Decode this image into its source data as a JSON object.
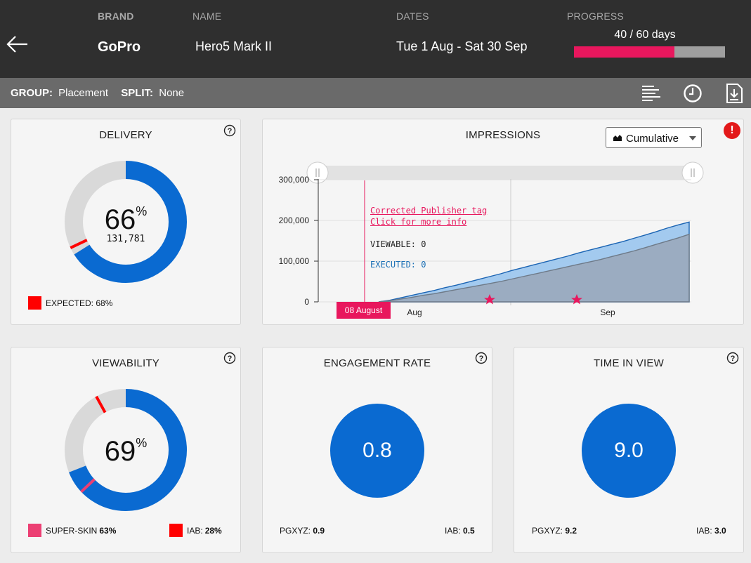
{
  "header": {
    "brand_label": "BRAND",
    "brand_value": "GoPro",
    "name_label": "NAME",
    "name_value": "Hero5 Mark II",
    "dates_label": "DATES",
    "dates_value": "Tue 1 Aug - Sat 30 Sep",
    "progress_label": "PROGRESS",
    "progress_text": "40 / 60 days",
    "progress_value": 40,
    "progress_total": 60
  },
  "subbar": {
    "group_label": "GROUP:",
    "group_value": "Placement",
    "split_label": "SPLIT:",
    "split_value": "None"
  },
  "delivery": {
    "title": "DELIVERY",
    "percent": "66",
    "pct_sign": "%",
    "value": "131,781",
    "expected_label": "EXPECTED: 68%",
    "percent_value": 66,
    "expected_value": 68
  },
  "impressions": {
    "title": "IMPRESSIONS",
    "mode": "Cumulative",
    "annotation_line1": "Corrected Publisher tag",
    "annotation_line2": "Click for more info",
    "viewable_label": "VIEWABLE: 0",
    "executed_label": "EXECUTED: 0",
    "date_flag": "08 August",
    "alert": "!"
  },
  "chart_data": {
    "type": "area",
    "y_ticks": [
      "300,000",
      "200,000",
      "100,000",
      "0"
    ],
    "x_ticks": [
      "Aug",
      "Sep"
    ],
    "ylim": [
      0,
      300000
    ],
    "series": [
      {
        "color": "#9ec7ee",
        "values": [
          0,
          4000,
          10000,
          16000,
          22000,
          28000,
          35000,
          41000,
          48000,
          55000,
          62000,
          69000,
          77000,
          84000,
          91000,
          98000,
          105000,
          112000,
          120000,
          127000,
          134000,
          141000,
          148000,
          156000,
          164000,
          172000,
          181000,
          189000,
          196000
        ]
      },
      {
        "color": "#9aa9bb",
        "values": [
          0,
          3000,
          7000,
          11000,
          16000,
          20000,
          25000,
          30000,
          35000,
          40000,
          45000,
          50000,
          56000,
          62000,
          68000,
          74000,
          80000,
          86000,
          92000,
          98000,
          104000,
          111000,
          118000,
          125000,
          133000,
          141000,
          149000,
          157000,
          166000
        ]
      }
    ]
  },
  "viewability": {
    "title": "VIEWABILITY",
    "percent": "69",
    "pct_sign": "%",
    "superskin_label": "SUPER-SKIN",
    "superskin_value": "63%",
    "iab_label": "IAB:",
    "iab_value": "28%",
    "percent_value": 69
  },
  "engagement": {
    "title": "ENGAGEMENT RATE",
    "value": "0.8",
    "pgxyz_label": "PGXYZ:",
    "pgxyz_value": "0.9",
    "iab_label": "IAB:",
    "iab_value": "0.5"
  },
  "timeinview": {
    "title": "TIME IN VIEW",
    "value": "9.0",
    "pgxyz_label": "PGXYZ:",
    "pgxyz_value": "9.2",
    "iab_label": "IAB:",
    "iab_value": "3.0"
  },
  "colors": {
    "accent_blue": "#0a6ad1",
    "accent_pink": "#e8175d",
    "expected_red": "#ff0000",
    "superskin_pink": "#ec3f73"
  },
  "icons": {
    "back": "arrow-left-icon",
    "list": "align-list-icon",
    "history": "clock-icon",
    "download": "download-file-icon",
    "help": "question-circle-icon",
    "alert": "exclamation-icon"
  }
}
